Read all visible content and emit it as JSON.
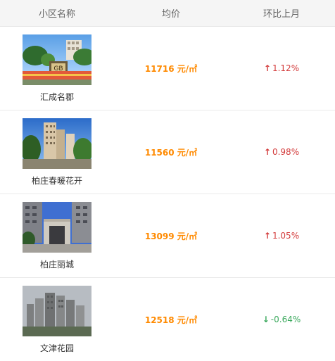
{
  "headers": {
    "name": "小区名称",
    "price": "均价",
    "change": "环比上月"
  },
  "rows": [
    {
      "name": "汇成名郡",
      "price": "11716 元/㎡",
      "change": "1.12%",
      "direction": "up",
      "arrow": "↑"
    },
    {
      "name": "柏庄春暖花开",
      "price": "11560 元/㎡",
      "change": "0.98%",
      "direction": "up",
      "arrow": "↑"
    },
    {
      "name": "柏庄丽城",
      "price": "13099 元/㎡",
      "change": "1.05%",
      "direction": "up",
      "arrow": "↑"
    },
    {
      "name": "文津花园",
      "price": "12518 元/㎡",
      "change": "-0.64%",
      "direction": "down",
      "arrow": "↓"
    }
  ]
}
